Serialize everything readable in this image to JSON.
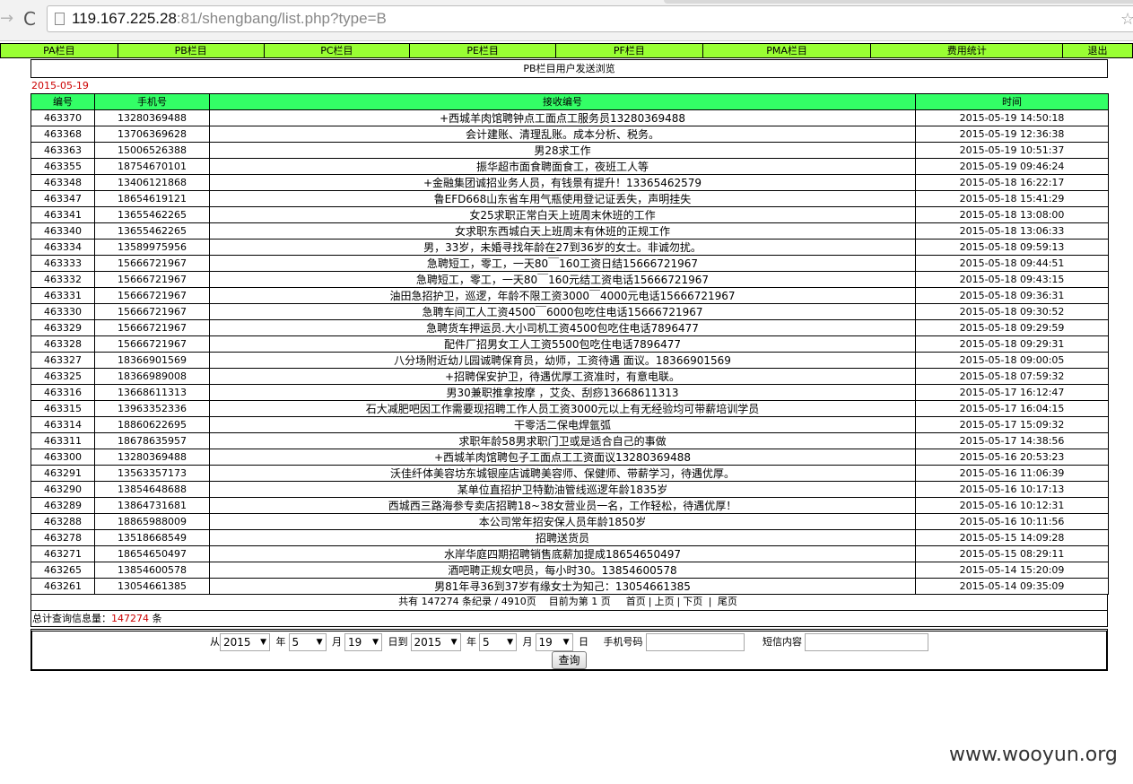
{
  "browser": {
    "url_host": "119.167.225.28",
    "url_rest": ":81/shengbang/list.php?type=B",
    "forward_glyph": "→",
    "reload_glyph": "C",
    "star_glyph": "☆"
  },
  "nav": {
    "items": [
      {
        "label": "PA栏目",
        "width": 131
      },
      {
        "label": "PB栏目",
        "width": 163
      },
      {
        "label": "PC栏目",
        "width": 163
      },
      {
        "label": "PE栏目",
        "width": 163
      },
      {
        "label": "PF栏目",
        "width": 164
      },
      {
        "label": "PMA栏目",
        "width": 188
      },
      {
        "label": "费用统计",
        "width": 214
      },
      {
        "label": "退出",
        "width": 77
      }
    ]
  },
  "page_title": "PB栏目用户发送浏览",
  "current_date": "2015-05-19",
  "table": {
    "headers": [
      "编号",
      "手机号",
      "接收编号",
      "时间"
    ],
    "rows": [
      [
        "463370",
        "13280369488",
        "+西城羊肉馆聘钟点工面点工服务员13280369488",
        "2015-05-19 14:50:18"
      ],
      [
        "463368",
        "13706369628",
        "会计建账、清理乱账。成本分析、税务。",
        "2015-05-19 12:36:38"
      ],
      [
        "463363",
        "15006526388",
        "男28求工作",
        "2015-05-19 10:51:37"
      ],
      [
        "463355",
        "18754670101",
        "振华超市面食聘面食工，夜班工人等",
        "2015-05-19 09:46:24"
      ],
      [
        "463348",
        "13406121868",
        "+金融集团诚招业务人员，有钱景有提升！13365462579",
        "2015-05-18 16:22:17"
      ],
      [
        "463347",
        "18654619121",
        "鲁EFD668山东省车用气瓶使用登记证丢失，声明挂失",
        "2015-05-18 15:41:29"
      ],
      [
        "463341",
        "13655462265",
        "女25求职正常白天上班周末休班的工作",
        "2015-05-18 13:08:00"
      ],
      [
        "463340",
        "13655462265",
        "女求职东西城白天上班周末有休班的正规工作",
        "2015-05-18 13:06:33"
      ],
      [
        "463334",
        "13589975956",
        "男，33岁，未婚寻找年龄在27到36岁的女士。非诚勿扰。",
        "2015-05-18 09:59:13"
      ],
      [
        "463333",
        "15666721967",
        "急聘短工，零工，一天80￣160工资日结15666721967",
        "2015-05-18 09:44:51"
      ],
      [
        "463332",
        "15666721967",
        "急聘短工，零工，一天80￣160元结工资电话15666721967",
        "2015-05-18 09:43:15"
      ],
      [
        "463331",
        "15666721967",
        "油田急招护卫，巡逻，年龄不限工资3000￣4000元电话15666721967",
        "2015-05-18 09:36:31"
      ],
      [
        "463330",
        "15666721967",
        "急聘车间工人工资4500￣6000包吃住电话15666721967",
        "2015-05-18 09:30:52"
      ],
      [
        "463329",
        "15666721967",
        "急聘货车押运员.大小司机工资4500包吃住电话7896477",
        "2015-05-18 09:29:59"
      ],
      [
        "463328",
        "15666721967",
        "配件厂招男女工人工资5500包吃住电话7896477",
        "2015-05-18 09:29:31"
      ],
      [
        "463327",
        "18366901569",
        "八分场附近幼儿园诚聘保育员，幼师，工资待遇 面议。18366901569",
        "2015-05-18 09:00:05"
      ],
      [
        "463325",
        "18366989008",
        "+招聘保安护卫，待遇优厚工资准时，有意电联。",
        "2015-05-18 07:59:32"
      ],
      [
        "463316",
        "13668611313",
        "男30兼职推拿按摩 ，艾灸、刮痧13668611313",
        "2015-05-17 16:12:47"
      ],
      [
        "463315",
        "13963352336",
        "石大减肥吧因工作需要现招聘工作人员工资3000元以上有无经验均可带薪培训学员",
        "2015-05-17 16:04:15"
      ],
      [
        "463314",
        "18860622695",
        "干零活二保电焊氩弧",
        "2015-05-17 15:09:32"
      ],
      [
        "463311",
        "18678635957",
        "求职年龄58男求职门卫或是适合自己的事做",
        "2015-05-17 14:38:56"
      ],
      [
        "463300",
        "13280369488",
        "+西城羊肉馆聘包子工面点工工资面议13280369488",
        "2015-05-16 20:53:23"
      ],
      [
        "463291",
        "13563357173",
        "沃佳纤体美容坊东城银座店诚聘美容师、保健师、带薪学习，待遇优厚。",
        "2015-05-16 11:06:39"
      ],
      [
        "463290",
        "13854648688",
        "某单位直招护卫特勤油管线巡逻年龄1835岁",
        "2015-05-16 10:17:13"
      ],
      [
        "463289",
        "13864731681",
        "西城西三路海参专卖店招聘18~38女营业员一名，工作轻松，待遇优厚！",
        "2015-05-16 10:12:31"
      ],
      [
        "463288",
        "18865988009",
        "本公司常年招安保人员年龄1850岁",
        "2015-05-16 10:11:56"
      ],
      [
        "463278",
        "13518668549",
        "招聘送货员",
        "2015-05-15 14:09:28"
      ],
      [
        "463271",
        "18654650497",
        "水岸华庭四期招聘销售底薪加提成18654650497",
        "2015-05-15 08:29:11"
      ],
      [
        "463265",
        "13854600578",
        "酒吧聘正规女吧员，每小时30。13854600578",
        "2015-05-14 15:20:09"
      ],
      [
        "463261",
        "13054661385",
        "男81年寻36到37岁有缘女士为知己：13054661385",
        "2015-05-14 09:35:09"
      ]
    ]
  },
  "pager": {
    "summary": "共有 147274 条纪录 / 4910页",
    "current": "目前为第 1 页",
    "first": "首页",
    "sep1": "|",
    "prev": "上页",
    "sep2": "|",
    "next": "下页",
    "sep3": "|",
    "last": "尾页"
  },
  "total": {
    "label": "总计查询信息量：",
    "value": "147274",
    "unit": "条"
  },
  "search": {
    "from_label": "从",
    "from_year": "2015",
    "year_label": "年",
    "from_month": "5",
    "month_label": "月",
    "from_day": "19",
    "day_to_label": "日到",
    "to_year": "2015",
    "to_year_label": "年",
    "to_month": "5",
    "to_month_label": "月",
    "to_day": "19",
    "to_day_label": "日",
    "phone_label": "手机号码",
    "content_label": "短信内容",
    "submit": "查询",
    "arrow": "▼"
  },
  "watermark": "www.wooyun.org"
}
